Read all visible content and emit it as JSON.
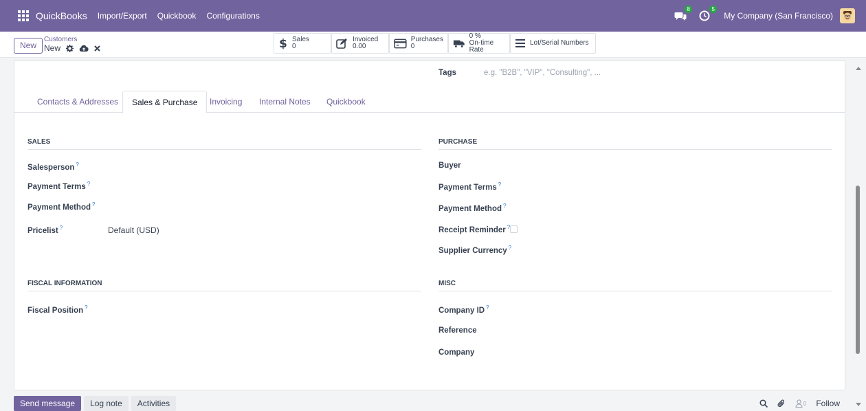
{
  "navbar": {
    "brand": "QuickBooks",
    "menus": [
      "Import/Export",
      "Quickbook",
      "Configurations"
    ],
    "messages_count": "8",
    "activities_count": "5",
    "company": "My Company (San Francisco)"
  },
  "control": {
    "new_label": "New",
    "breadcrumb_parent": "Customers",
    "record_name": "New"
  },
  "smart_buttons": [
    {
      "label": "Sales",
      "value": "0"
    },
    {
      "label": "Invoiced",
      "value": "0.00"
    },
    {
      "label": "Purchases",
      "value": "0"
    },
    {
      "label": "0 %",
      "value": "On-time Rate"
    },
    {
      "label": "Lot/Serial Numbers",
      "value": ""
    }
  ],
  "form": {
    "tags_label": "Tags",
    "tags_placeholder": "e.g. \"B2B\", \"VIP\", \"Consulting\", ...",
    "tabs": [
      "Contacts & Addresses",
      "Sales & Purchase",
      "Invoicing",
      "Internal Notes",
      "Quickbook"
    ],
    "active_tab": "Sales & Purchase",
    "sales": {
      "title": "SALES",
      "salesperson": "Salesperson",
      "payment_terms": "Payment Terms",
      "payment_method": "Payment Method",
      "pricelist": "Pricelist",
      "pricelist_value": "Default (USD)"
    },
    "purchase": {
      "title": "PURCHASE",
      "buyer": "Buyer",
      "payment_terms": "Payment Terms",
      "payment_method": "Payment Method",
      "receipt_reminder": "Receipt Reminder",
      "supplier_currency": "Supplier Currency"
    },
    "fiscal": {
      "title": "FISCAL INFORMATION",
      "fiscal_position": "Fiscal Position"
    },
    "misc": {
      "title": "MISC",
      "company_id": "Company ID",
      "reference": "Reference",
      "company": "Company"
    },
    "help_mark": "?"
  },
  "chatter": {
    "send_message": "Send message",
    "log_note": "Log note",
    "activities": "Activities",
    "followers_count": "0",
    "follow": "Follow"
  },
  "colors": {
    "brand": "#71639e",
    "badge": "#28a745",
    "help": "#2c7ad6"
  }
}
